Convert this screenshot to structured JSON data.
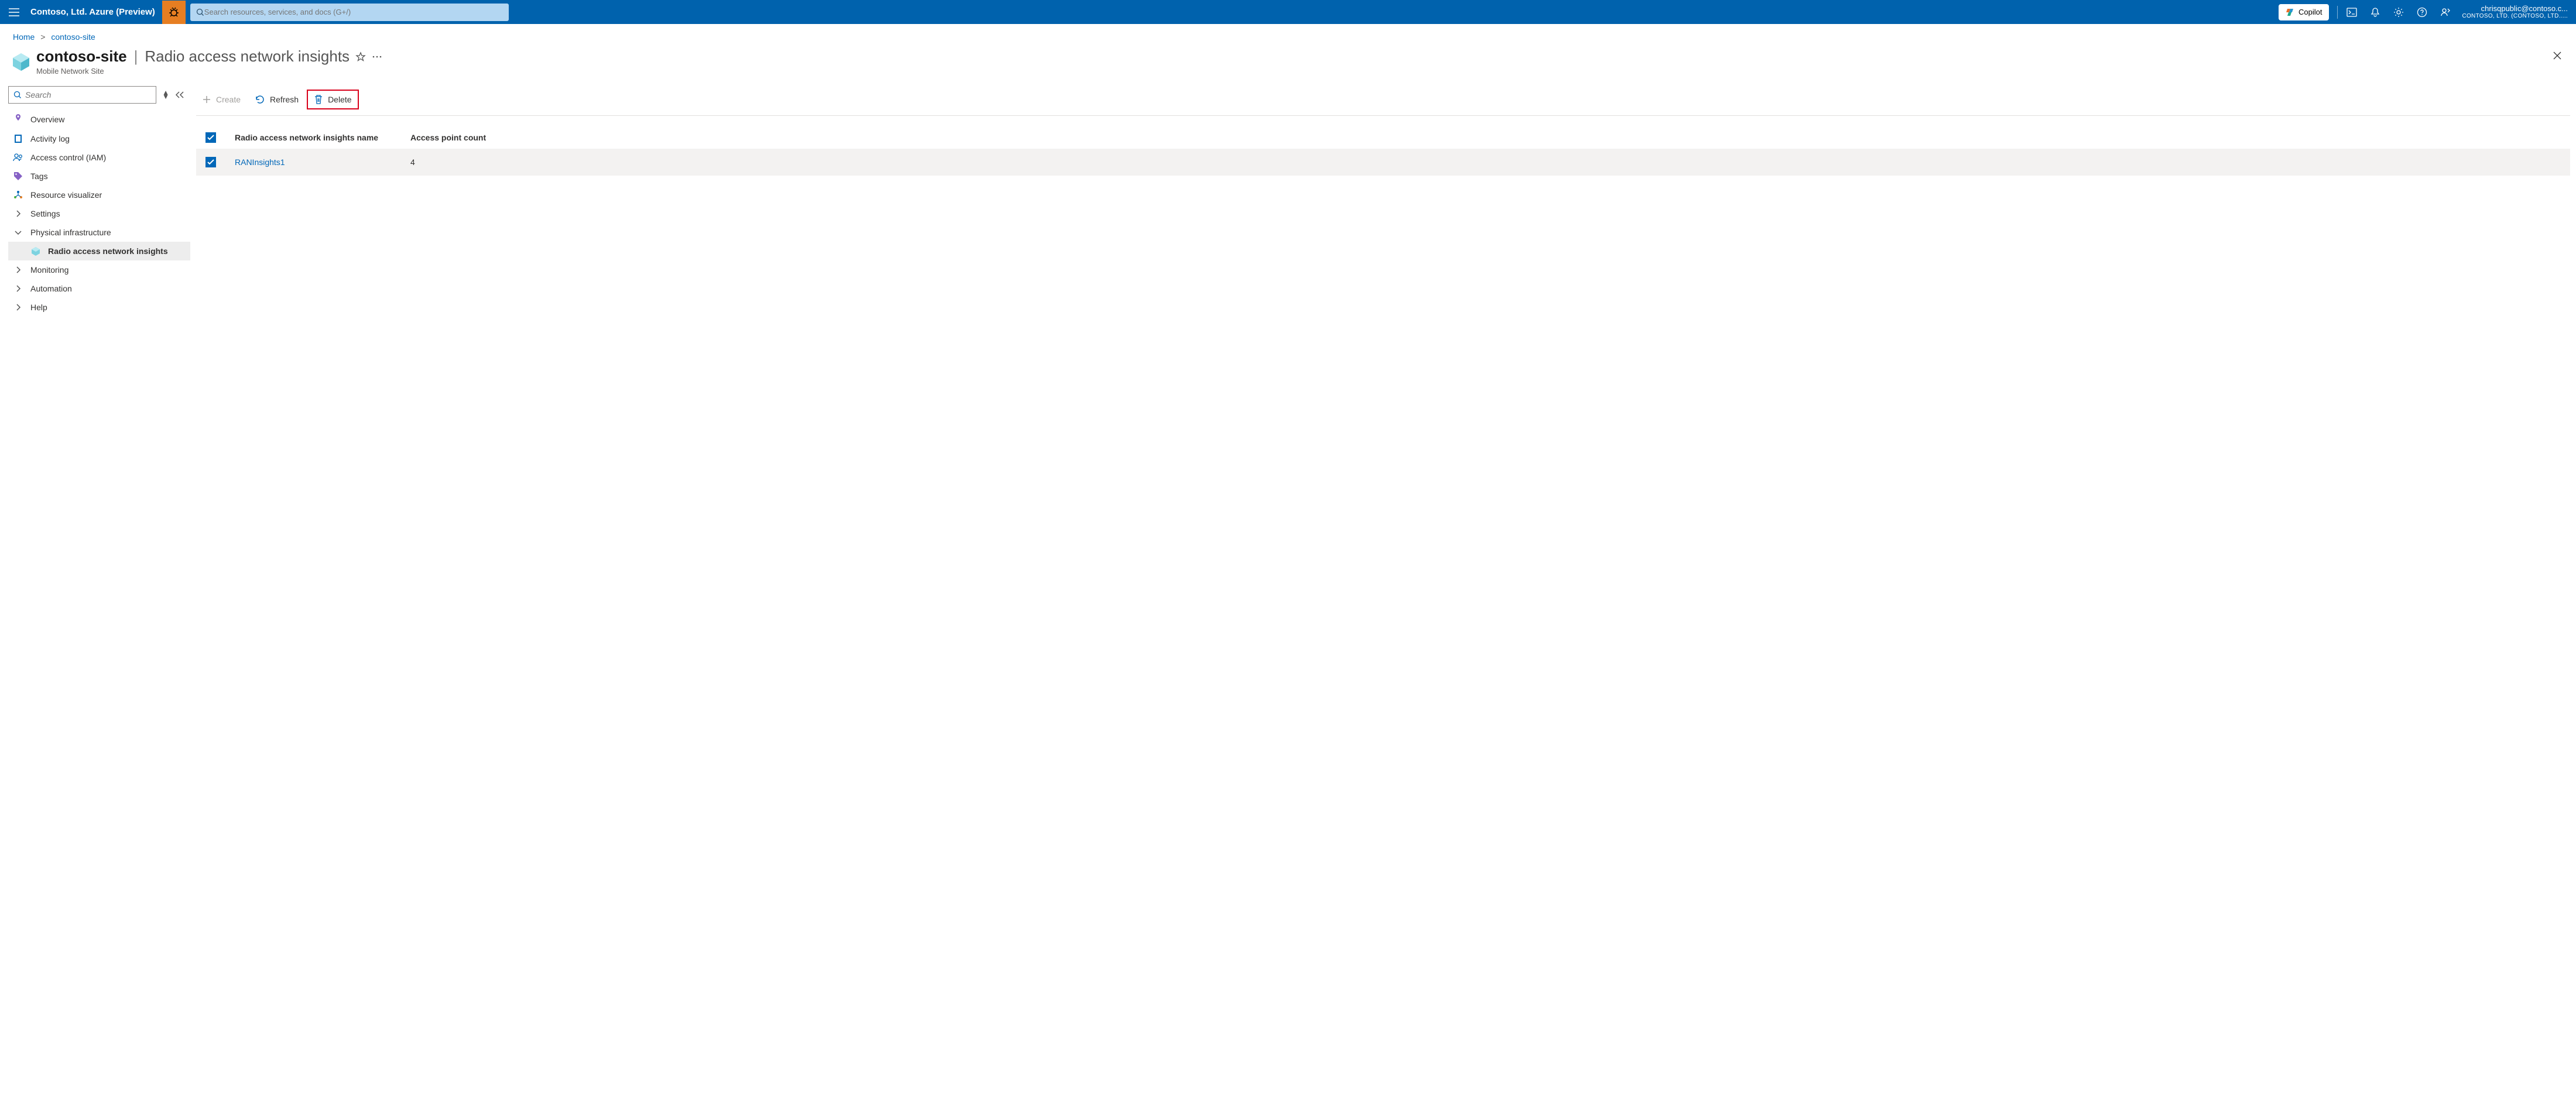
{
  "topbar": {
    "brand": "Contoso, Ltd. Azure (Preview)",
    "search_placeholder": "Search resources, services, and docs (G+/)",
    "copilot_label": "Copilot",
    "user_email": "chrisqpublic@contoso.c...",
    "user_tenant": "CONTOSO, LTD. (CONTOSO, LTD....."
  },
  "breadcrumb": {
    "home": "Home",
    "current": "contoso-site"
  },
  "page": {
    "title": "contoso-site",
    "subtitle": "Radio access network insights",
    "type": "Mobile Network Site"
  },
  "sidebar": {
    "search_placeholder": "Search",
    "items": {
      "overview": "Overview",
      "activity_log": "Activity log",
      "iam": "Access control (IAM)",
      "tags": "Tags",
      "resource_visualizer": "Resource visualizer",
      "settings": "Settings",
      "physical_infra": "Physical infrastructure",
      "ran_insights": "Radio access network insights",
      "monitoring": "Monitoring",
      "automation": "Automation",
      "help": "Help"
    }
  },
  "toolbar": {
    "create": "Create",
    "refresh": "Refresh",
    "delete": "Delete"
  },
  "grid": {
    "headers": {
      "name": "Radio access network insights name",
      "count": "Access point count"
    },
    "rows": [
      {
        "name": "RANInsights1",
        "count": "4"
      }
    ]
  }
}
